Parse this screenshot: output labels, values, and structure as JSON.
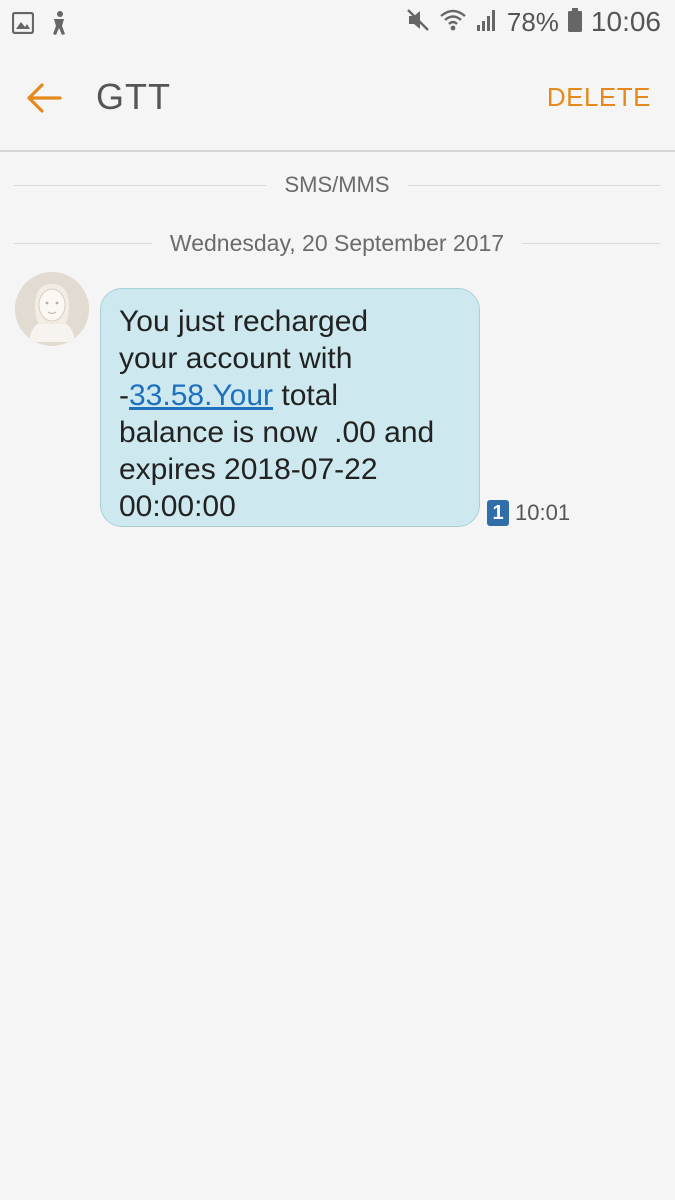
{
  "status_bar": {
    "left_icons": [
      "image-notification-icon",
      "accessibility-icon"
    ],
    "right_icons": [
      "mute-icon",
      "wifi-icon",
      "signal-icon",
      "battery-icon"
    ],
    "battery_percent": "78%",
    "time": "10:06"
  },
  "app_bar": {
    "back_icon": "back-arrow-icon",
    "title": "GTT",
    "delete_label": "DELETE",
    "accent_color": "#e5891a"
  },
  "conversation": {
    "channel_label": "SMS/MMS",
    "date_label": "Wednesday, 20 September 2017",
    "messages": [
      {
        "avatar_icon": "contact-avatar-icon",
        "text_line1": "You just recharged",
        "text_line2": "your account with",
        "text_line3_prefix": "-",
        "text_link": "33.58.Your",
        "text_line3_suffix": " total",
        "text_line4": "balance is now  .00 and",
        "text_line5": "expires 2018-07-22",
        "text_line6": "00:00:00",
        "sim_label": "1",
        "time": "10:01",
        "bubble_color": "#cde9ef"
      }
    ]
  }
}
